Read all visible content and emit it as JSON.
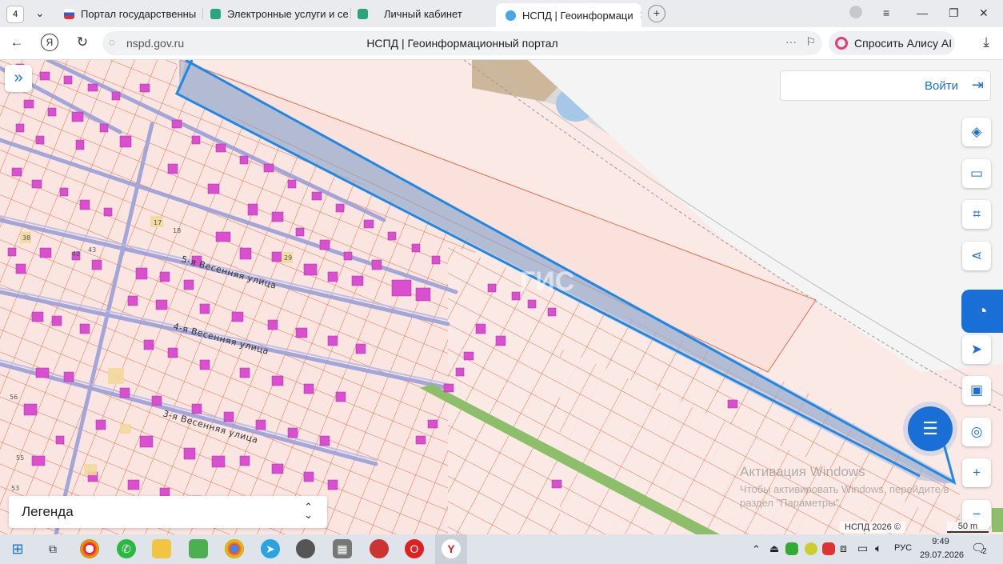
{
  "browser": {
    "tab_count": "4",
    "tabs": [
      {
        "label": "Портал государственных",
        "icon": "flag-icon"
      },
      {
        "label": "Электронные услуги и се",
        "icon": "gosuslugi-icon"
      },
      {
        "label": "Личный кабинет",
        "icon": "gosuslugi-icon"
      },
      {
        "label": "НСПД | Геоинформаци",
        "icon": "nspd-icon",
        "active": true
      }
    ],
    "url": "nspd.gov.ru",
    "page_title": "НСПД | Геоинформационный портал",
    "alice_label": "Спросить Алису AI"
  },
  "map": {
    "login_label": "Войти",
    "streets": [
      "5-я Весенняя улица",
      "4-я Весенняя улица",
      "3-я Весенняя улица"
    ],
    "house_numbers": [
      "17",
      "18",
      "29",
      "38",
      "42",
      "43",
      "56",
      "55",
      "53"
    ],
    "legend_label": "Легенда",
    "copyright": "НСПД 2026 ©",
    "scale_label": "50 m",
    "watermark_bg": "ГИС",
    "colors": {
      "selection": "#1e88e5",
      "parcel_line": "#e0704a",
      "building": "#d94fd0",
      "road": "#9aa0d8",
      "green_strip": "#8dbf6a"
    }
  },
  "windows_watermark": {
    "title": "Активация Windows",
    "text": "Чтобы активировать Windows, перейдите в раздел \"Параметры\"."
  },
  "taskbar": {
    "language": "РУС",
    "time": "9:49",
    "date": "29.07.2026",
    "notifications": "2"
  }
}
